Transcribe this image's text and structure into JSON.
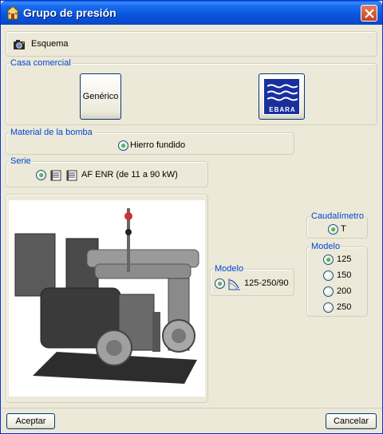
{
  "window": {
    "title": "Grupo de presión"
  },
  "schema": {
    "label": "Esquema"
  },
  "casa_comercial": {
    "legend": "Casa comercial",
    "generic_label": "Genérico",
    "brand_logo_text": "EBARA"
  },
  "material": {
    "legend": "Material de la bomba",
    "option": "Hierro fundido"
  },
  "serie": {
    "legend": "Serie",
    "option": "AF ENR (de 11 a 90 kW)"
  },
  "modelo_main": {
    "legend": "Modelo",
    "option": "125-250/90"
  },
  "caudalimetro": {
    "legend": "Caudalímetro",
    "option": "T"
  },
  "modelo_sizes": {
    "legend": "Modelo",
    "options": [
      "125",
      "150",
      "200",
      "250"
    ],
    "selected": "125"
  },
  "footer": {
    "accept_label": "Aceptar",
    "cancel_label": "Cancelar"
  },
  "colors": {
    "title_bar": "#0855dd",
    "legend_text": "#0046d5",
    "dialog_bg": "#ece9d8",
    "brand_blue": "#1a2f9e"
  }
}
